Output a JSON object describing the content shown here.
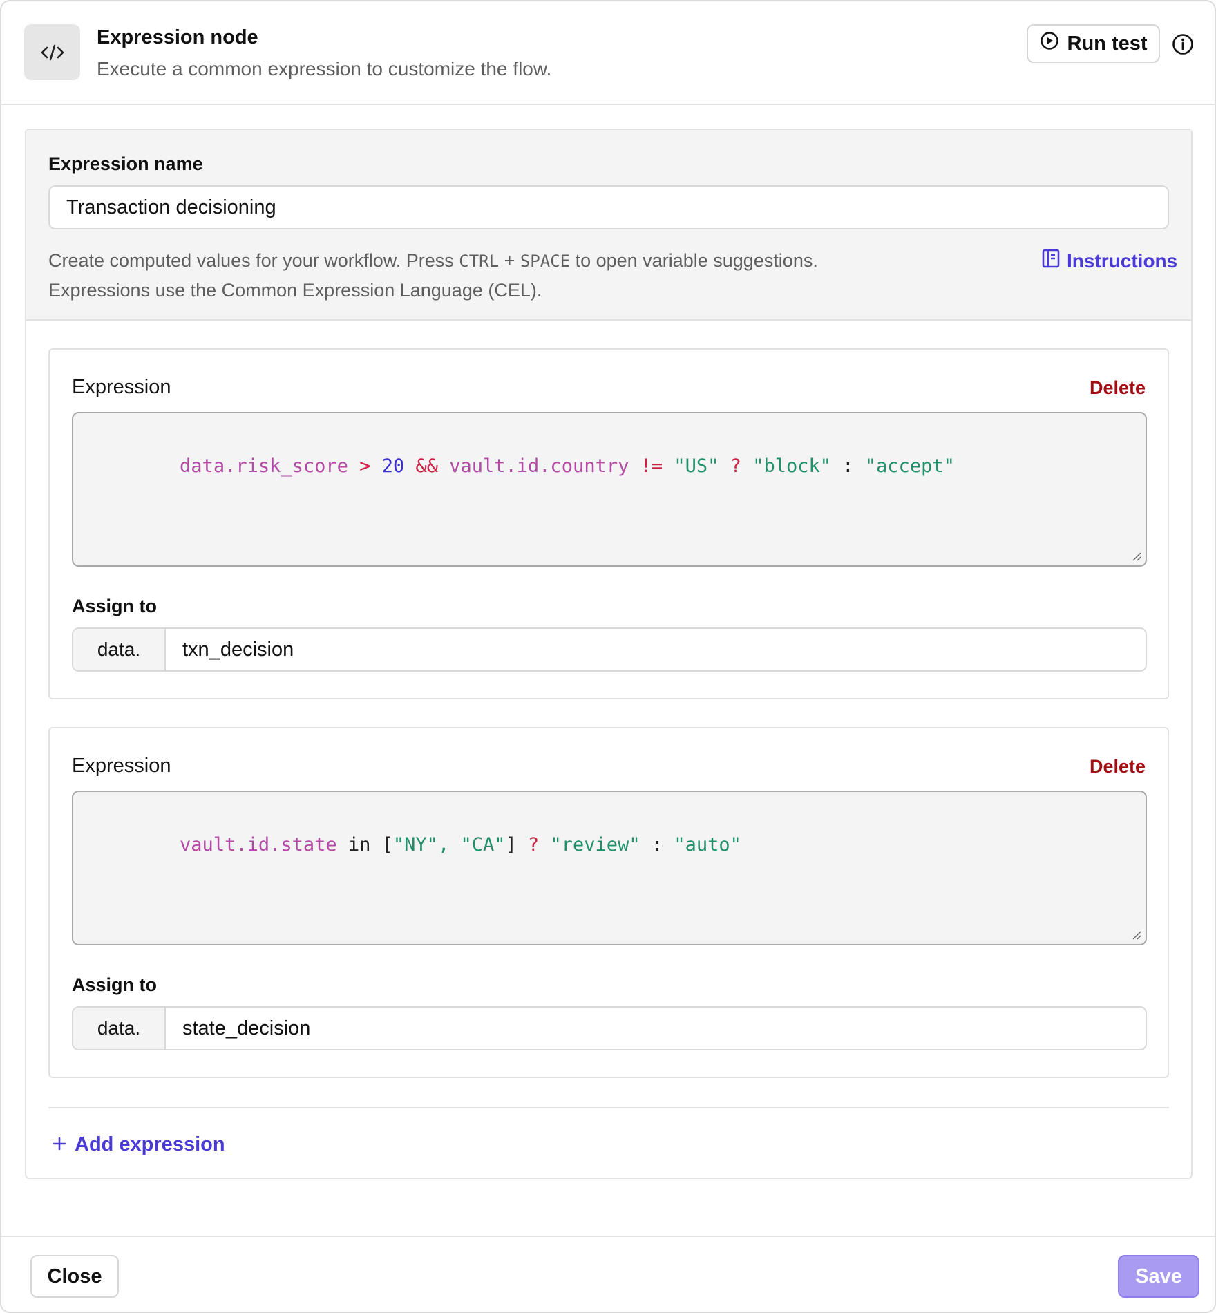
{
  "header": {
    "title": "Expression node",
    "subtitle": "Execute a common expression to customize the flow.",
    "run_test_label": "Run test",
    "icon": "code-icon"
  },
  "name_section": {
    "label": "Expression name",
    "value": "Transaction decisioning",
    "help_part1": "Create computed values for your workflow. Press ",
    "help_key1": "CTRL",
    "help_plus": " + ",
    "help_key2": "SPACE",
    "help_part2": " to open variable suggestions.",
    "help_line2": "Expressions use the Common Expression Language (CEL).",
    "instructions_label": "Instructions"
  },
  "expressions": [
    {
      "label": "Expression",
      "delete_label": "Delete",
      "tokens": [
        {
          "t": "data.risk_score",
          "k": "var"
        },
        {
          "t": " ",
          "k": "plain"
        },
        {
          "t": ">",
          "k": "op"
        },
        {
          "t": " ",
          "k": "plain"
        },
        {
          "t": "20",
          "k": "num"
        },
        {
          "t": " ",
          "k": "plain"
        },
        {
          "t": "&&",
          "k": "op"
        },
        {
          "t": " ",
          "k": "plain"
        },
        {
          "t": "vault.id.country",
          "k": "var"
        },
        {
          "t": " ",
          "k": "plain"
        },
        {
          "t": "!=",
          "k": "op"
        },
        {
          "t": " ",
          "k": "plain"
        },
        {
          "t": "\"US\"",
          "k": "str"
        },
        {
          "t": " ",
          "k": "plain"
        },
        {
          "t": "?",
          "k": "op"
        },
        {
          "t": " ",
          "k": "plain"
        },
        {
          "t": "\"block\"",
          "k": "str"
        },
        {
          "t": " : ",
          "k": "plain"
        },
        {
          "t": "\"accept\"",
          "k": "str"
        }
      ],
      "assign_label": "Assign to",
      "assign_prefix": "data.",
      "assign_value": "txn_decision"
    },
    {
      "label": "Expression",
      "delete_label": "Delete",
      "tokens": [
        {
          "t": "vault.id.state",
          "k": "var"
        },
        {
          "t": " in [",
          "k": "plain"
        },
        {
          "t": "\"NY\"",
          "k": "str"
        },
        {
          "t": ", ",
          "k": "str"
        },
        {
          "t": "\"CA\"",
          "k": "str"
        },
        {
          "t": "] ",
          "k": "plain"
        },
        {
          "t": "?",
          "k": "op"
        },
        {
          "t": " ",
          "k": "plain"
        },
        {
          "t": "\"review\"",
          "k": "str"
        },
        {
          "t": " : ",
          "k": "plain"
        },
        {
          "t": "\"auto\"",
          "k": "str"
        }
      ],
      "assign_label": "Assign to",
      "assign_prefix": "data.",
      "assign_value": "state_decision"
    }
  ],
  "add_expression_label": "Add expression",
  "footer": {
    "close_label": "Close",
    "save_label": "Save"
  },
  "colors": {
    "accent": "#4a3bd6",
    "danger": "#a30e14",
    "save_disabled": "#a99cf0"
  }
}
